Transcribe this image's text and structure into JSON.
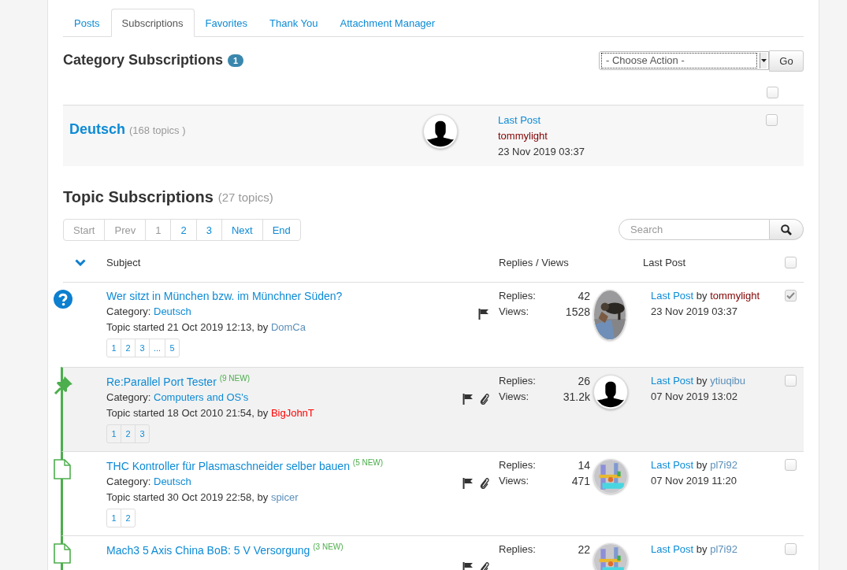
{
  "tabs": [
    {
      "label": "Posts",
      "selected": false
    },
    {
      "label": "Subscriptions",
      "selected": true
    },
    {
      "label": "Favorites",
      "selected": false
    },
    {
      "label": "Thank You",
      "selected": false
    },
    {
      "label": "Attachment Manager",
      "selected": false
    }
  ],
  "category_subscriptions": {
    "title": "Category Subscriptions",
    "count": "1",
    "action_select": "- Choose Action -",
    "go_button": "Go",
    "select_all_checked": false,
    "rows": [
      {
        "name": "Deutsch",
        "topics": "(168 topics )",
        "avatar": {
          "kind": "silhouette"
        },
        "last_post_label": "Last Post",
        "last_post_user": {
          "name": "tommylight",
          "color": "#800000"
        },
        "last_post_date": "23 Nov 2019 03:37",
        "checked": false
      }
    ]
  },
  "topic_subscriptions": {
    "title": "Topic Subscriptions",
    "count": "(27 topics)",
    "pagination": [
      {
        "label": "Start",
        "disabled": true
      },
      {
        "label": "Prev",
        "disabled": true
      },
      {
        "label": "1",
        "disabled": true
      },
      {
        "label": "2",
        "disabled": false
      },
      {
        "label": "3",
        "disabled": false
      },
      {
        "label": "Next",
        "disabled": false
      },
      {
        "label": "End",
        "disabled": false
      }
    ],
    "search_placeholder": "Search",
    "columns": [
      "Subject",
      "Replies / Views",
      "Last Post"
    ],
    "select_all_checked": false,
    "rows": [
      {
        "kind": "question",
        "unread": false,
        "title": "Wer sitzt in München bzw. im Münchner Süden?",
        "category_label": "Category:",
        "category": "Deutsch",
        "started": "Topic started 21 Oct 2019 12:13, by",
        "starter": {
          "name": "DomCa",
          "color": "#5b8fb9"
        },
        "pages": [
          "1",
          "2",
          "3",
          "...",
          "5"
        ],
        "attachment": false,
        "replies_label": "Replies:",
        "replies": "42",
        "views_label": "Views:",
        "views": "1528",
        "last_post_label": "Last Post",
        "by": "by",
        "last_post_user": {
          "name": "tommylight",
          "color": "#800000"
        },
        "last_post_date": "23 Nov 2019 03:37",
        "checked": true
      },
      {
        "kind": "pinned",
        "unread": true,
        "title": "Re:Parallel Port Tester $^{(9 NEW)}$",
        "category_label": "Category:",
        "category": "Computers and OS's",
        "started": "Topic started 18 Oct 2010 21:54, by",
        "starter": {
          "name": "BigJohnT",
          "color": "#ff0000"
        },
        "pages": [
          "1",
          "2",
          "3"
        ],
        "attachment": true,
        "replies_label": "Replies:",
        "replies": "26",
        "views_label": "Views:",
        "views": "31.2k",
        "avatar": {
          "kind": "silhouette"
        },
        "last_post_label": "Last Post",
        "by": "by",
        "last_post_user": {
          "name": "ytiuqibu",
          "color": "#5b8fb9"
        },
        "last_post_date": "07 Nov 2019 13:02",
        "checked": false
      },
      {
        "kind": "topic",
        "unread": true,
        "title": "THC Kontroller für Plasmaschneider selber bauen $^{(5 NEW)}$",
        "category_label": "Category:",
        "category": "Deutsch",
        "started": "Topic started 30 Oct 2019 22:58, by",
        "starter": {
          "name": "spicer",
          "color": "#5b8fb9"
        },
        "pages": [
          "1",
          "2"
        ],
        "attachment": true,
        "replies_label": "Replies:",
        "replies": "14",
        "views_label": "Views:",
        "views": "471",
        "avatar": {
          "kind": "render"
        },
        "last_post_label": "Last Post",
        "by": "by",
        "last_post_user": {
          "name": "pl7i92",
          "color": "#5b8fb9"
        },
        "last_post_date": "07 Nov 2019 11:20",
        "checked": false
      },
      {
        "kind": "topic",
        "unread": true,
        "title": "Mach3 5 Axis China BoB: 5 V Versorgung $^{(3 NEW)}$",
        "attachment": true,
        "replies_label": "Replies:",
        "replies": "22",
        "avatar": {
          "kind": "render"
        },
        "last_post_label": "Last Post",
        "by": "by",
        "last_post_user": {
          "name": "pl7i92",
          "color": "#5b8fb9"
        },
        "checked": false
      }
    ]
  }
}
